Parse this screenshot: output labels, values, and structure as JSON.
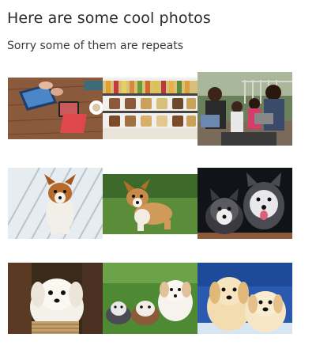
{
  "page": {
    "title": "Here are some cool photos",
    "subtitle": "Sorry some of them are repeats"
  },
  "gallery": {
    "rows": [
      {
        "photos": [
          {
            "subject": "hands using laptop and tablet on a wooden desk"
          },
          {
            "subject": "shelves of snack jars in a store"
          },
          {
            "subject": "family looking at laptop and tablet on a porch"
          }
        ]
      },
      {
        "photos": [
          {
            "subject": "corgi puppy sitting on white wooden deck"
          },
          {
            "subject": "corgi puppy on green grass"
          },
          {
            "subject": "two husky puppies"
          }
        ]
      },
      {
        "photos": [
          {
            "subject": "white fluffy puppy in a basket"
          },
          {
            "subject": "three puppies lying on grass"
          },
          {
            "subject": "two golden retriever puppies"
          }
        ]
      }
    ]
  }
}
